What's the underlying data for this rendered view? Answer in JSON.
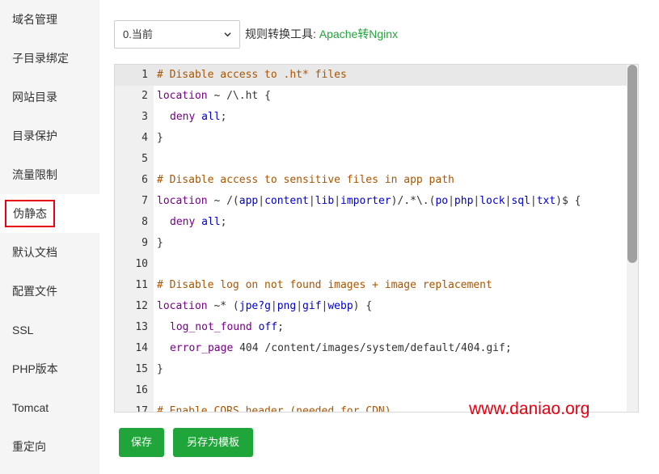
{
  "sidebar": {
    "items": [
      {
        "label": "域名管理"
      },
      {
        "label": "子目录绑定"
      },
      {
        "label": "网站目录"
      },
      {
        "label": "目录保护"
      },
      {
        "label": "流量限制"
      },
      {
        "label": "伪静态",
        "active": true
      },
      {
        "label": "默认文档"
      },
      {
        "label": "配置文件"
      },
      {
        "label": "SSL"
      },
      {
        "label": "PHP版本"
      },
      {
        "label": "Tomcat"
      },
      {
        "label": "重定向"
      }
    ]
  },
  "toolbar": {
    "select_value": "0.当前",
    "tool_label": "规则转换工具:",
    "tool_link": "Apache转Nginx"
  },
  "editor": {
    "active_line": 1,
    "lines": [
      {
        "n": "1",
        "indent": 0,
        "tokens": [
          [
            "c-com",
            "# Disable access to .ht* files"
          ]
        ]
      },
      {
        "n": "2",
        "indent": 0,
        "tokens": [
          [
            "c-kw",
            "location"
          ],
          [
            "",
            " ~ /\\.ht {"
          ]
        ]
      },
      {
        "n": "3",
        "indent": 1,
        "tokens": [
          [
            "c-kw",
            "deny"
          ],
          [
            "",
            " "
          ],
          [
            "c-var",
            "all"
          ],
          [
            "",
            ";"
          ]
        ]
      },
      {
        "n": "4",
        "indent": 0,
        "tokens": [
          [
            "",
            "}"
          ]
        ]
      },
      {
        "n": "5",
        "indent": 0,
        "tokens": []
      },
      {
        "n": "6",
        "indent": 0,
        "tokens": [
          [
            "c-com",
            "# Disable access to sensitive files in app path"
          ]
        ]
      },
      {
        "n": "7",
        "indent": 0,
        "tokens": [
          [
            "c-kw",
            "location"
          ],
          [
            "",
            " ~ /("
          ],
          [
            "c-var",
            "app"
          ],
          [
            "",
            "|"
          ],
          [
            "c-var",
            "content"
          ],
          [
            "",
            "|"
          ],
          [
            "c-var",
            "lib"
          ],
          [
            "",
            "|"
          ],
          [
            "c-var",
            "importer"
          ],
          [
            "",
            ")/.*\\.("
          ],
          [
            "c-var",
            "po"
          ],
          [
            "",
            "|"
          ],
          [
            "c-var",
            "php"
          ],
          [
            "",
            "|"
          ],
          [
            "c-var",
            "lock"
          ],
          [
            "",
            "|"
          ],
          [
            "c-var",
            "sql"
          ],
          [
            "",
            "|"
          ],
          [
            "c-var",
            "txt"
          ],
          [
            "",
            ")$ {"
          ]
        ]
      },
      {
        "n": "8",
        "indent": 1,
        "tokens": [
          [
            "c-kw",
            "deny"
          ],
          [
            "",
            " "
          ],
          [
            "c-var",
            "all"
          ],
          [
            "",
            ";"
          ]
        ]
      },
      {
        "n": "9",
        "indent": 0,
        "tokens": [
          [
            "",
            "}"
          ]
        ]
      },
      {
        "n": "10",
        "indent": 0,
        "tokens": []
      },
      {
        "n": "11",
        "indent": 0,
        "tokens": [
          [
            "c-com",
            "# Disable log on not found images + image replacement"
          ]
        ]
      },
      {
        "n": "12",
        "indent": 0,
        "tokens": [
          [
            "c-kw",
            "location"
          ],
          [
            "",
            " ~* ("
          ],
          [
            "c-var",
            "jpe?g"
          ],
          [
            "",
            "|"
          ],
          [
            "c-var",
            "png"
          ],
          [
            "",
            "|"
          ],
          [
            "c-var",
            "gif"
          ],
          [
            "",
            "|"
          ],
          [
            "c-var",
            "webp"
          ],
          [
            "",
            ") {"
          ]
        ]
      },
      {
        "n": "13",
        "indent": 1,
        "tokens": [
          [
            "c-kw",
            "log_not_found"
          ],
          [
            "",
            " "
          ],
          [
            "c-var",
            "off"
          ],
          [
            "",
            ";"
          ]
        ]
      },
      {
        "n": "14",
        "indent": 1,
        "tokens": [
          [
            "c-kw",
            "error_page"
          ],
          [
            "",
            " 404 /content/images/system/default/404.gif;"
          ]
        ]
      },
      {
        "n": "15",
        "indent": 0,
        "tokens": [
          [
            "",
            "}"
          ]
        ]
      },
      {
        "n": "16",
        "indent": 0,
        "tokens": []
      },
      {
        "n": "17",
        "indent": 0,
        "tokens": [
          [
            "c-com",
            "# Enable CORS header (needed for CDN)"
          ]
        ]
      }
    ],
    "scroll_fraction": 0.0
  },
  "watermark": "www.daniao.org",
  "buttons": {
    "save": "保存",
    "save_template": "另存为模板"
  },
  "colors": {
    "accent": "#20a53a",
    "highlight_border": "#e60012",
    "watermark": "#e60012"
  }
}
